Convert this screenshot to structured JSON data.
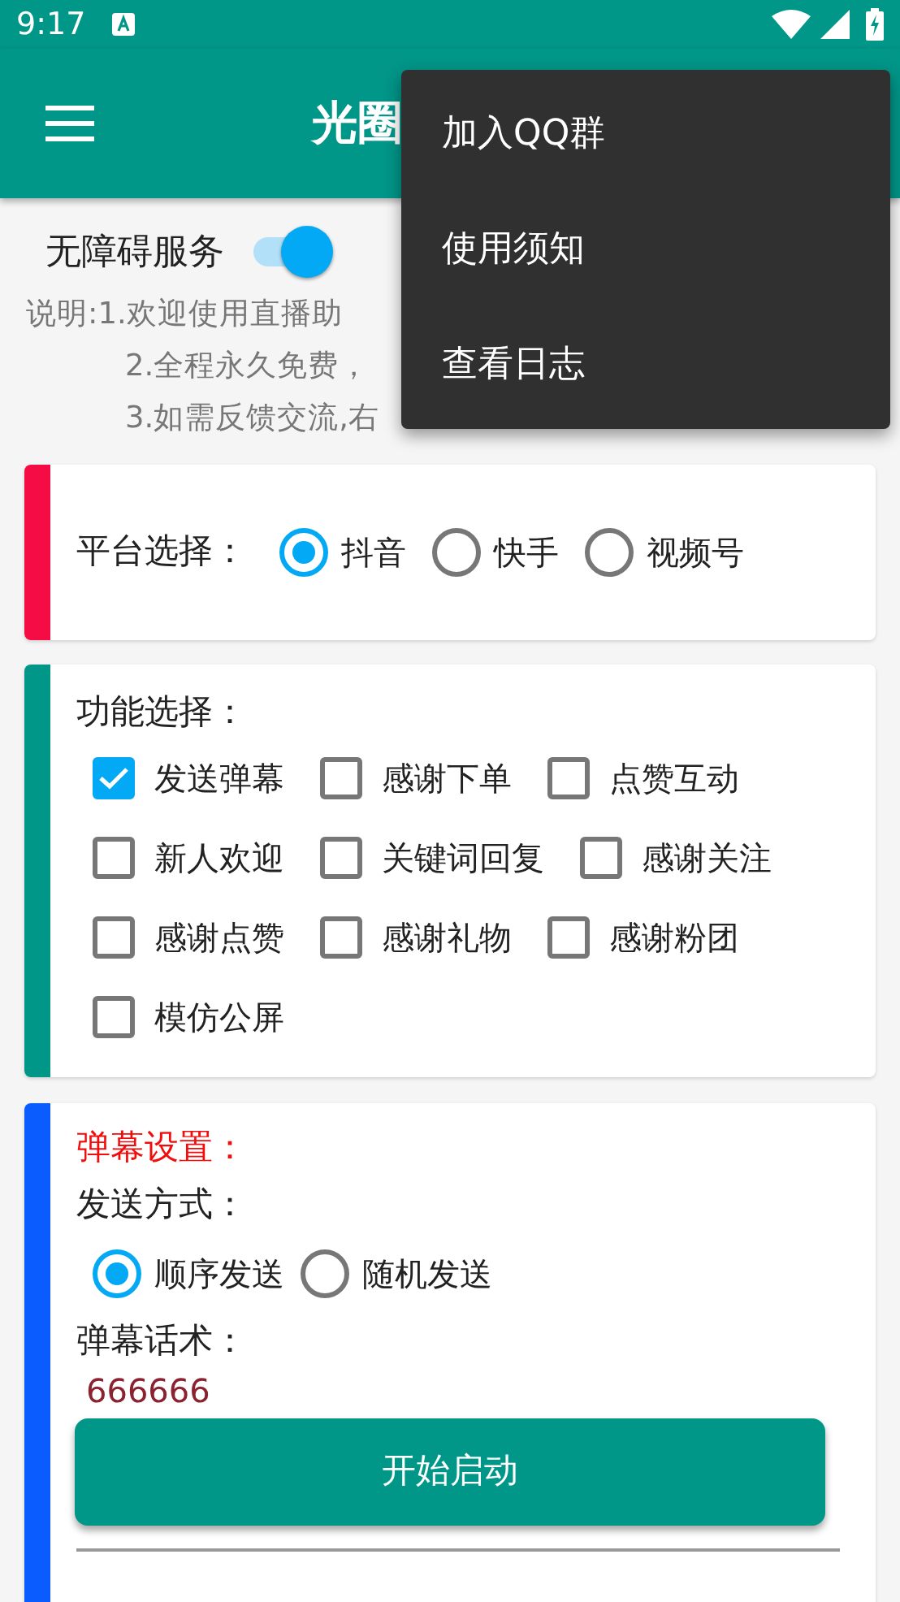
{
  "status_bar": {
    "time": "9:17"
  },
  "app_bar": {
    "title": "光圈"
  },
  "menu": {
    "items": [
      "加入QQ群",
      "使用须知",
      "查看日志"
    ]
  },
  "accessibility": {
    "label": "无障碍服务",
    "on": true
  },
  "notes": [
    "说明:1.欢迎使用直播助",
    "2.全程永久免费，",
    "3.如需反馈交流,右"
  ],
  "platform": {
    "label": "平台选择：",
    "options": [
      {
        "label": "抖音",
        "selected": true
      },
      {
        "label": "快手",
        "selected": false
      },
      {
        "label": "视频号",
        "selected": false
      }
    ]
  },
  "functions": {
    "label": "功能选择：",
    "options": [
      {
        "label": "发送弹幕",
        "checked": true
      },
      {
        "label": "感谢下单",
        "checked": false
      },
      {
        "label": "点赞互动",
        "checked": false
      },
      {
        "label": "新人欢迎",
        "checked": false
      },
      {
        "label": "关键词回复",
        "checked": false
      },
      {
        "label": "感谢关注",
        "checked": false
      },
      {
        "label": "感谢点赞",
        "checked": false
      },
      {
        "label": "感谢礼物",
        "checked": false
      },
      {
        "label": "感谢粉团",
        "checked": false
      },
      {
        "label": "模仿公屏",
        "checked": false
      }
    ]
  },
  "danmaku": {
    "title": "弹幕设置：",
    "send_mode_label": "发送方式：",
    "send_modes": [
      {
        "label": "顺序发送",
        "selected": true
      },
      {
        "label": "随机发送",
        "selected": false
      }
    ],
    "script_label": "弹幕话术：",
    "script_lines": [
      "666666"
    ]
  },
  "start_button": "开始启动"
}
